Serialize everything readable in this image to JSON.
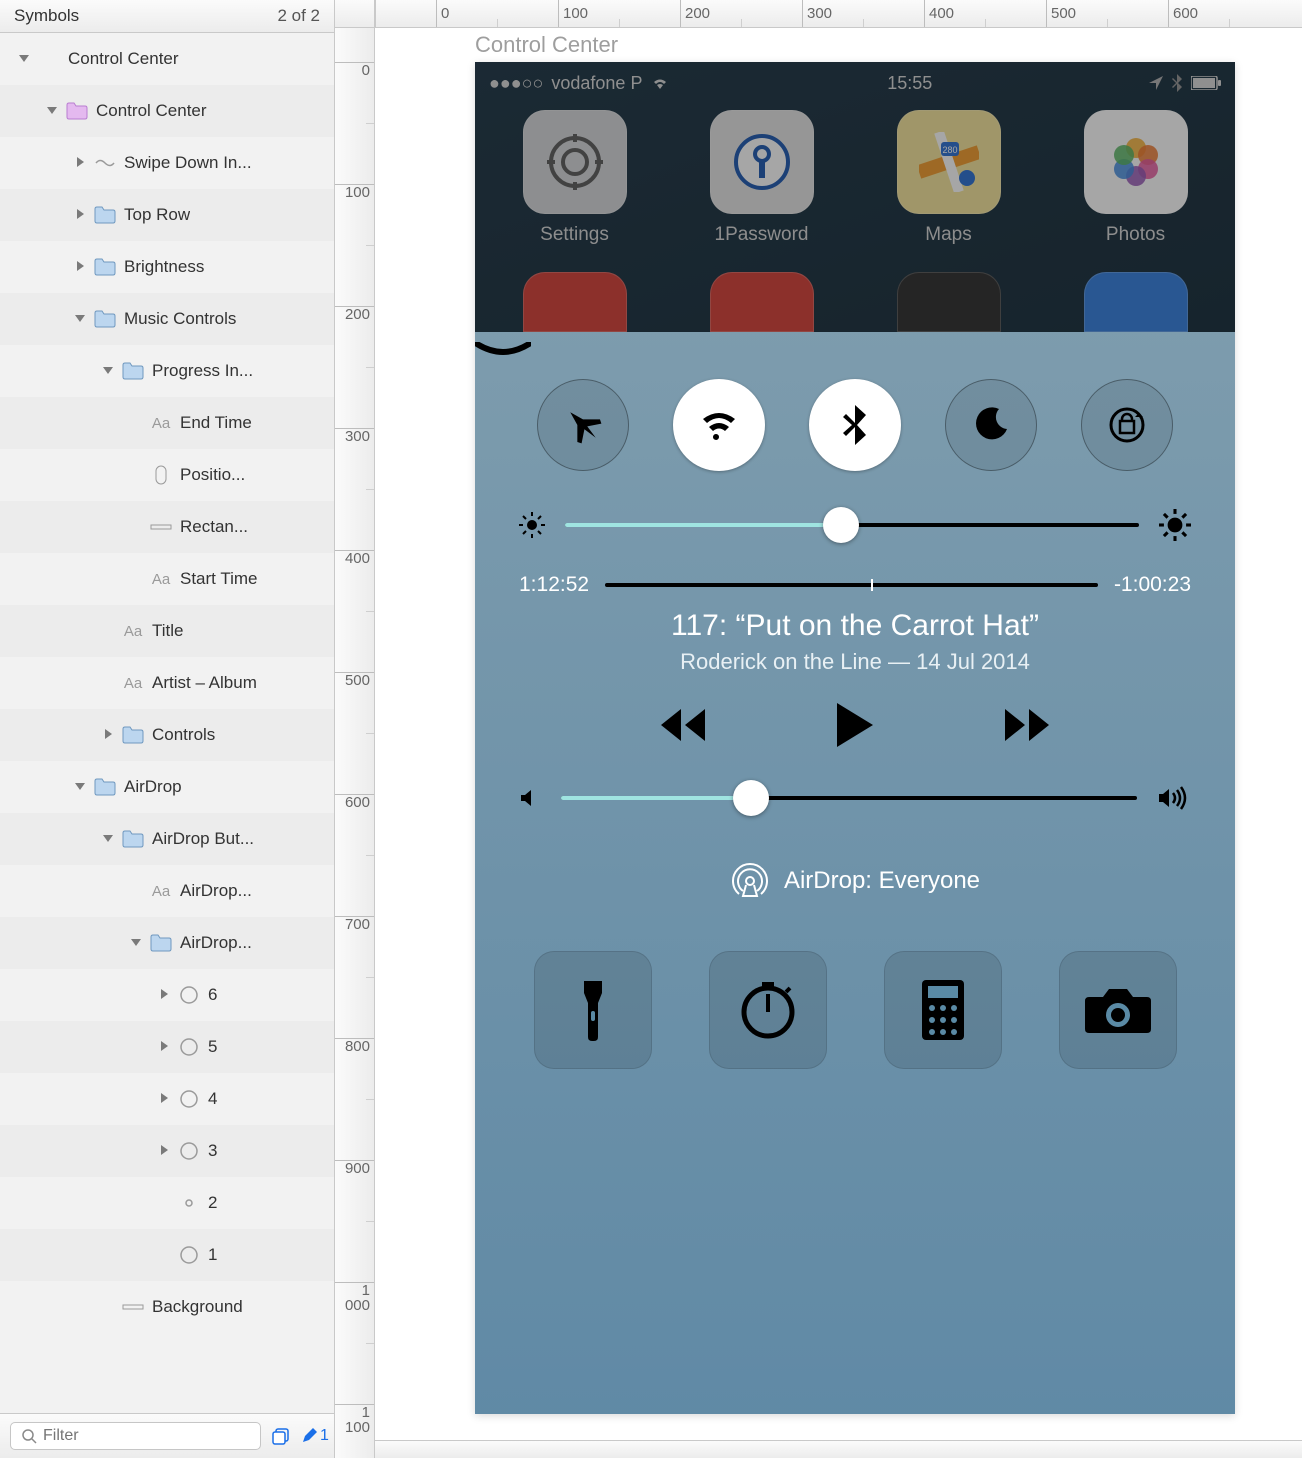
{
  "sidebar": {
    "header": {
      "title": "Symbols",
      "count": "2 of 2"
    },
    "filter_placeholder": "Filter",
    "stack_count": "1",
    "layers": [
      {
        "indent": 0,
        "icon": "disclosure-down",
        "type": "group",
        "label": "Control Center"
      },
      {
        "indent": 1,
        "icon": "disclosure-down",
        "type": "folder-purple",
        "label": "Control Center"
      },
      {
        "indent": 2,
        "icon": "disclosure-right",
        "type": "symbol",
        "label": "Swipe Down In..."
      },
      {
        "indent": 2,
        "icon": "disclosure-right",
        "type": "folder",
        "label": "Top Row"
      },
      {
        "indent": 2,
        "icon": "disclosure-right",
        "type": "folder",
        "label": "Brightness"
      },
      {
        "indent": 2,
        "icon": "disclosure-down",
        "type": "folder",
        "label": "Music Controls"
      },
      {
        "indent": 3,
        "icon": "disclosure-down",
        "type": "folder",
        "label": "Progress In..."
      },
      {
        "indent": 4,
        "icon": "none",
        "type": "text",
        "label": "End Time"
      },
      {
        "indent": 4,
        "icon": "none",
        "type": "rounded",
        "label": "Positio..."
      },
      {
        "indent": 4,
        "icon": "none",
        "type": "rect",
        "label": "Rectan..."
      },
      {
        "indent": 4,
        "icon": "none",
        "type": "text",
        "label": "Start Time"
      },
      {
        "indent": 3,
        "icon": "none",
        "type": "text",
        "label": "Title"
      },
      {
        "indent": 3,
        "icon": "none",
        "type": "text",
        "label": "Artist – Album"
      },
      {
        "indent": 3,
        "icon": "disclosure-right",
        "type": "folder",
        "label": "Controls"
      },
      {
        "indent": 2,
        "icon": "disclosure-down",
        "type": "folder",
        "label": "AirDrop"
      },
      {
        "indent": 3,
        "icon": "disclosure-down",
        "type": "folder",
        "label": "AirDrop But..."
      },
      {
        "indent": 4,
        "icon": "none",
        "type": "text",
        "label": "AirDrop..."
      },
      {
        "indent": 4,
        "icon": "disclosure-down",
        "type": "folder",
        "label": "AirDrop..."
      },
      {
        "indent": 5,
        "icon": "disclosure-right",
        "type": "oval",
        "label": "6"
      },
      {
        "indent": 5,
        "icon": "disclosure-right",
        "type": "oval",
        "label": "5"
      },
      {
        "indent": 5,
        "icon": "disclosure-right",
        "type": "oval",
        "label": "4"
      },
      {
        "indent": 5,
        "icon": "disclosure-right",
        "type": "oval",
        "label": "3"
      },
      {
        "indent": 5,
        "icon": "none",
        "type": "oval-small",
        "label": "2"
      },
      {
        "indent": 5,
        "icon": "none",
        "type": "oval",
        "label": "1"
      },
      {
        "indent": 3,
        "icon": "none",
        "type": "rect",
        "label": "Background"
      }
    ]
  },
  "ruler": {
    "h_ticks": [
      "0",
      "100",
      "200",
      "300",
      "400",
      "500",
      "600"
    ],
    "v_ticks": [
      "0",
      "100",
      "200",
      "300",
      "400",
      "500",
      "600",
      "700",
      "800",
      "900",
      "1 000",
      "1 100"
    ]
  },
  "artboard": {
    "title": "Control Center",
    "statusbar": {
      "carrier": "vodafone P",
      "signal": "●●●○○",
      "time": "15:55"
    },
    "apps": [
      {
        "label": "Settings",
        "bg": "#d9dbdd",
        "fg": "#555"
      },
      {
        "label": "1Password",
        "bg": "#e7e7e7",
        "fg": "#2b63b5"
      },
      {
        "label": "Maps",
        "bg": "#f6e7a1",
        "fg": "#4aa046"
      },
      {
        "label": "Photos",
        "bg": "#ffffff",
        "fg": "#e85ea2"
      }
    ],
    "apps_row2_colors": [
      "#d74a43",
      "#d74a43",
      "#3a3a3a",
      "#3f86e0"
    ],
    "cc": {
      "toggles": [
        {
          "name": "airplane",
          "on": false
        },
        {
          "name": "wifi",
          "on": true
        },
        {
          "name": "bluetooth",
          "on": true
        },
        {
          "name": "dnd",
          "on": false
        },
        {
          "name": "rotation",
          "on": false
        }
      ],
      "brightness_pct": 48,
      "progress": {
        "start": "1:12:52",
        "end": "-1:00:23",
        "pct": 54
      },
      "track_title": "117: “Put on the Carrot Hat”",
      "track_sub": "Roderick on the Line — 14 Jul 2014",
      "volume_pct": 33,
      "airdrop_label": "AirDrop: Everyone",
      "quick": [
        "flashlight",
        "timer",
        "calculator",
        "camera"
      ]
    }
  }
}
